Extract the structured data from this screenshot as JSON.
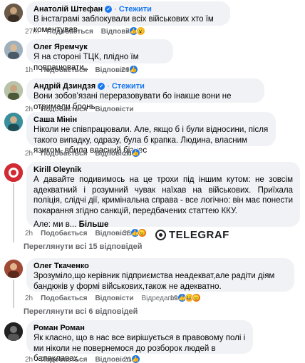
{
  "follow_label": "Стежити",
  "like_label": "Подобається",
  "reply_label": "Відповісти",
  "edited_label": "Відредаговано",
  "more_label": "Більше",
  "watermark": "TELEGRAF",
  "comments": [
    {
      "author": "Анатолій Штефан",
      "verified": true,
      "text": "В інстаграмі заблокували всіх військових хто їм коментував.",
      "time": "27m",
      "reactions_count": "7",
      "reactions": [
        "like",
        "wow"
      ]
    },
    {
      "author": "Олег Яремчук",
      "verified": false,
      "text": "Я на стороні ТЦК, плідно їм попрацювати..",
      "time": "1h",
      "reactions_count": "26",
      "reactions": [
        "like"
      ]
    },
    {
      "author": "Андрій Дзиндзя",
      "verified": true,
      "text": "Вони зобов'язані переразовувати бо інакше вони не отримали бронь",
      "time": "2h",
      "reactions_count": "",
      "reactions": []
    },
    {
      "author": "Саша Мінін",
      "verified": false,
      "text": "Ніколи не співпрацювали. Але, якщо б і були відносини, після такого випадку, одразу, була б крапка. Людина, власним язиком, вбила власний бізнес",
      "time": "2h",
      "reactions_count": "26",
      "reactions": [
        "like"
      ]
    },
    {
      "author": "Kirill Oleynik",
      "verified": false,
      "text": "А давайте подивимось на це трохи під іншим кутом: не зовсім адекватний і розумний чувак наїхав на військових. Приїхала поліція, слідчі дії, кримінальна справа - все логічно: він має понести покарання згідно санкцій, передбачених статтею ККУ.",
      "text2": "Але: ми в...",
      "time": "2h",
      "reactions_count": "33",
      "reactions": [
        "like",
        "angry"
      ],
      "view_replies": "Переглянути всі 15 відповідей"
    },
    {
      "author": "Олег Ткаченко",
      "verified": false,
      "text": "Зрозуміло,що керівник підприємства неадекват,але радіти діям бандюків у формі військових,також не адекватно.",
      "time": "2h",
      "edited": true,
      "reactions_count": "19",
      "reactions": [
        "like",
        "haha",
        "angry"
      ],
      "view_replies": "Переглянути всі 6 відповідей"
    },
    {
      "author": "Роман Роман",
      "verified": false,
      "text": "Як класно, що в нас все вирішується в правовому полі і ми ніколи не повернемося до розборок людей в балаклавах",
      "time": "2h",
      "reactions_count": "21",
      "reactions": [
        "like"
      ]
    }
  ],
  "colors": {
    "bubble": "#f0f2f5",
    "link": "#1877f2",
    "meta": "#65676b"
  }
}
